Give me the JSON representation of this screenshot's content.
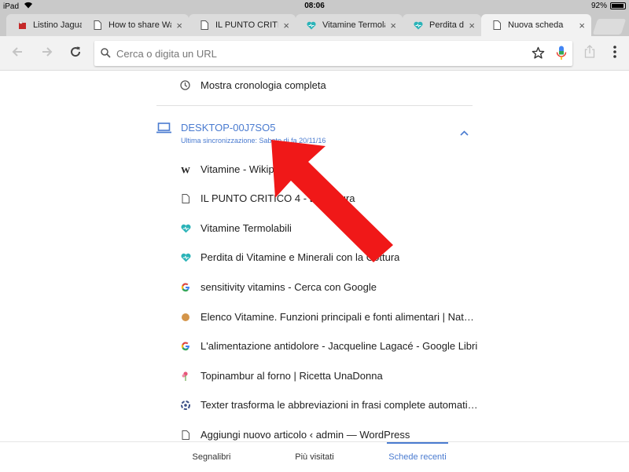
{
  "status_bar": {
    "device": "iPad",
    "time": "08:06",
    "battery": "92%",
    "battery_level": 0.92
  },
  "tabs": [
    {
      "label": "Listino Jaguar",
      "icon": "red-favicon-icon",
      "close": "×"
    },
    {
      "label": "How to share Wall",
      "icon": "page-icon",
      "close": "×"
    },
    {
      "label": "IL PUNTO CRITICO",
      "icon": "page-icon",
      "close": "×"
    },
    {
      "label": "Vitamine Termolabili",
      "icon": "heart-icon",
      "close": "×"
    },
    {
      "label": "Perdita di Vi",
      "icon": "heart-icon",
      "close": "×"
    },
    {
      "label": "Nuova scheda",
      "icon": "page-icon",
      "close": "×",
      "active": true
    }
  ],
  "omnibox": {
    "placeholder": "Cerca o digita un URL"
  },
  "history": {
    "label": "Mostra cronologia completa"
  },
  "device": {
    "name": "DESKTOP-00J7SO5",
    "sync": "Ultima sincronizzazione: Sabato di fa 20/11/16"
  },
  "entries": [
    {
      "text": "Vitamine - Wikipedia",
      "icon": "wikipedia-icon"
    },
    {
      "text": "IL PUNTO CRITICO 4 - La cottura",
      "icon": "page-icon"
    },
    {
      "text": "Vitamine Termolabili",
      "icon": "heart-icon"
    },
    {
      "text": "Perdita di Vitamine e Minerali con la Cottura",
      "icon": "heart-icon"
    },
    {
      "text": "sensitivity vitamins - Cerca con Google",
      "icon": "google-icon"
    },
    {
      "text": "Elenco Vitamine. Funzioni principali e fonti alimentari | Natur...",
      "icon": "orange-dot-icon"
    },
    {
      "text": "L'alimentazione antidolore - Jacqueline Lagacé - Google Libri",
      "icon": "google-icon"
    },
    {
      "text": "Topinambur al forno | Ricetta UnaDonna",
      "icon": "flower-icon"
    },
    {
      "text": "Texter trasforma le abbreviazioni in frasi complete automatic...",
      "icon": "texter-icon"
    },
    {
      "text": "Aggiungi nuovo articolo ‹ admin — WordPress",
      "icon": "page-icon"
    }
  ],
  "bottom_nav": {
    "bookmarks": "Segnalibri",
    "most_visited": "Più visitati",
    "recent_tabs": "Schede recenti"
  },
  "colors": {
    "accent": "#4a7bd0",
    "arrow": "#f01818",
    "heart": "#2bb3b8"
  }
}
